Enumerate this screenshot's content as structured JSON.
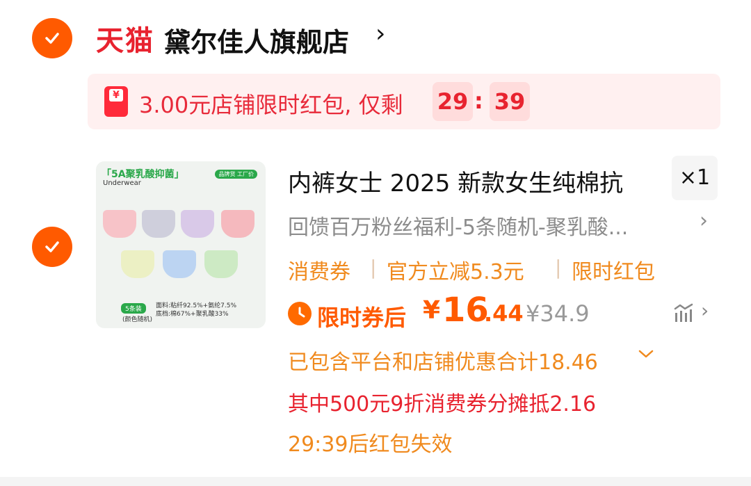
{
  "store": {
    "platform_logo": "天猫",
    "name": "黛尔佳人旗舰店",
    "chevron": "›"
  },
  "promo": {
    "icon": "red-envelope-icon",
    "icon_symbol": "¥",
    "text": "3.00元店铺限时红包, 仅剩",
    "minutes": "29",
    "separator": ":",
    "seconds": "39"
  },
  "product": {
    "image": {
      "tag": "「5A聚乳酸抑菌」",
      "subtitle": "Underwear",
      "badge": "品牌货 工厂价",
      "pack_badge": "5条装",
      "pack_note": "(颜色随机)",
      "fabric_line1": "面料:粘纤92.5%+氨纶7.5%",
      "fabric_line2": "底档:棉67%+聚乳酸33%"
    },
    "title": "内裤女士 2025 新款女生纯棉抗",
    "quantity": "×1",
    "sku": "回馈百万粉丝福利-5条随机-聚乳酸...",
    "coupons": [
      "消费券",
      "官方立减5.3元",
      "限时红包"
    ],
    "coupon_separator": "|",
    "price_label": "限时券后",
    "price_symbol": "¥",
    "price_integer": "16",
    "price_decimal": ".44",
    "original_price": "¥34.9",
    "discount_text": "已包含平台和店铺优惠合计18.46",
    "split_text": "其中500元9折消费券分摊抵2.16",
    "expire_text": "29:39后红包失效"
  },
  "colors": {
    "accent": "#ff5a00",
    "tmall_red": "#e8232f",
    "coupon_orange": "#f08a1e",
    "muted_gray": "#8c8c8c"
  }
}
